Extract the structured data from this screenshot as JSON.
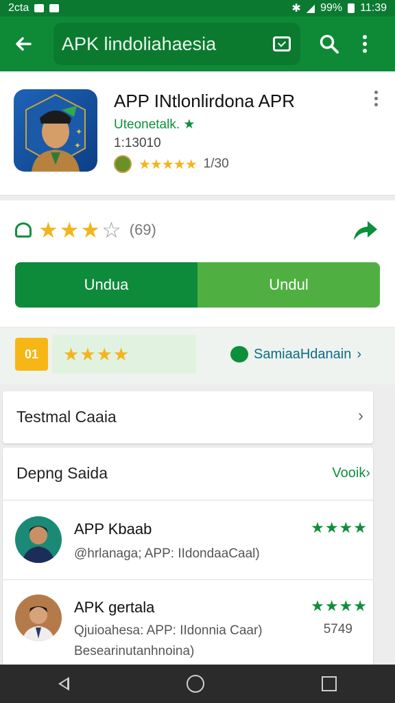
{
  "status_bar": {
    "carrier": "2cta",
    "battery": "99%",
    "time": "11:39"
  },
  "app_bar": {
    "query": "APK lindoliahaesia"
  },
  "app": {
    "title": "APP INtlonlirdona APR",
    "developer": "Uteonetalk.",
    "developer_badge": "★",
    "version": "1:13010",
    "stars": "★★★★★",
    "rating_count": "1/30"
  },
  "rating": {
    "stars_filled": "★★★",
    "star_empty": "☆",
    "count": "(69)"
  },
  "buttons": {
    "primary": "Undua",
    "secondary": "Undul"
  },
  "promo": {
    "icon_text": "01",
    "stars": "★★★★",
    "link": "SamiaaHdanain",
    "chevron": "›"
  },
  "testmal": {
    "title": "Testmal Caaia",
    "chevron": "›"
  },
  "reviews": {
    "title": "Depng Saida",
    "see_all": "Vooik›",
    "items": [
      {
        "name": "APP Kbaab",
        "text": "@hrlanaga; APP: IIdondaaCaal)",
        "stars": "★★★★"
      },
      {
        "name": "APK gertala",
        "text": "Qjuioahesa: APP: IIdonnia Caar)",
        "text2": "Besearinutanhnoina)",
        "stars": "★★★★",
        "count": "5749"
      }
    ]
  },
  "colors": {
    "primary": "#0e8a37",
    "accent": "#4fb041",
    "star": "#f2b51c"
  }
}
